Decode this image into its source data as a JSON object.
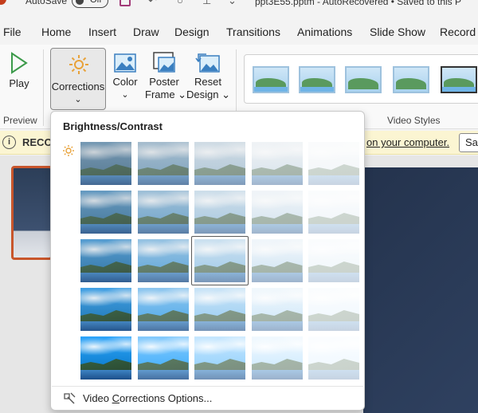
{
  "titlebar": {
    "autosave_label": "AutoSave",
    "autosave_state": "Off",
    "document_title": "ppt3E55.pptm - AutoRecovered • Saved to this P"
  },
  "menu": {
    "tabs": [
      "File",
      "Home",
      "Insert",
      "Draw",
      "Design",
      "Transitions",
      "Animations",
      "Slide Show",
      "Record"
    ]
  },
  "ribbon": {
    "play_label": "Play",
    "preview_group": "Preview",
    "corrections_label": "Corrections",
    "color_label": "Color",
    "poster_label_1": "Poster",
    "poster_label_2": "Frame",
    "reset_label_1": "Reset",
    "reset_label_2": "Design",
    "video_styles_group": "Video Styles"
  },
  "infobar": {
    "label": "RECOV",
    "link_text": "on your computer.",
    "button_label": "Sav"
  },
  "dropdown": {
    "heading": "Brightness/Contrast",
    "options_label_pre": "Video ",
    "options_label_underlined": "C",
    "options_label_post": "orrections Options...",
    "grid_rows": 5,
    "grid_cols": 5,
    "selected_cell": {
      "row": 2,
      "col": 2
    }
  },
  "colors": {
    "accent": "#c8562c",
    "slide_bg": "#2f4160",
    "info_bar": "#fbf5d2"
  }
}
